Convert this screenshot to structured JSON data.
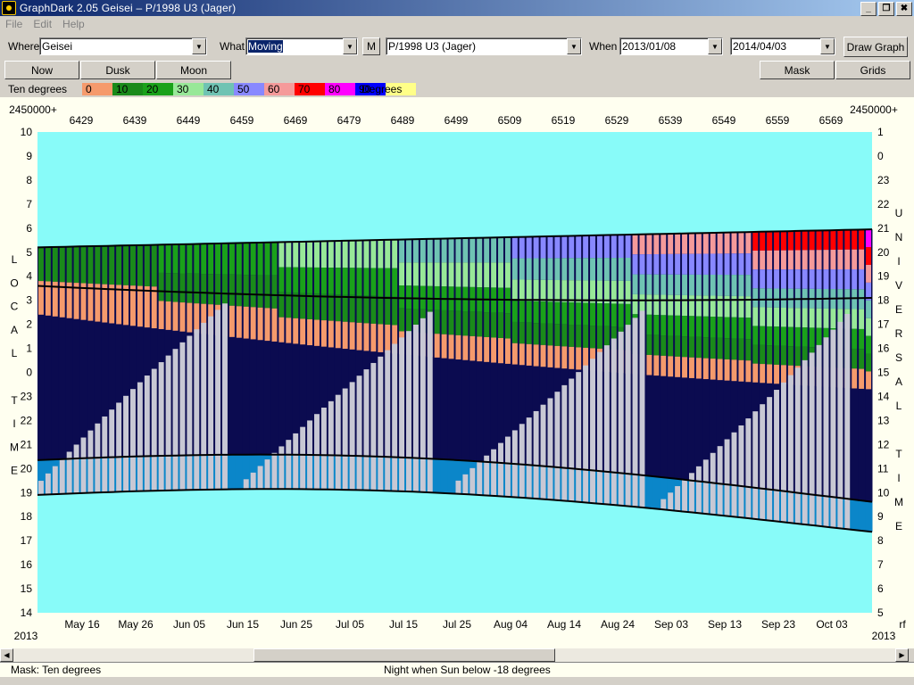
{
  "window": {
    "title": "GraphDark 2.05  Geisei  –  P/1998 U3 (Jager)",
    "buttons": [
      "_",
      "❐",
      "✖"
    ]
  },
  "menu": [
    "File",
    "Edit",
    "Help"
  ],
  "toolbar": {
    "where_label": "Where",
    "where_value": "Geisei",
    "what_label": "What",
    "what_value": "Moving",
    "m_button": "M",
    "object_value": "P/1998 U3 (Jager)",
    "when_label": "When",
    "start_date": "2013/01/08",
    "end_date": "2014/04/03",
    "draw_graph": "Draw Graph"
  },
  "buttons_row": {
    "now": "Now",
    "dusk": "Dusk",
    "moon": "Moon",
    "mask": "Mask",
    "grids": "Grids"
  },
  "legend": {
    "title": "Ten degrees",
    "unit": "Degrees",
    "items": [
      {
        "label": "0",
        "color": "#f59a6c"
      },
      {
        "label": "10",
        "color": "#1a8a1a"
      },
      {
        "label": "20",
        "color": "#1aa11a"
      },
      {
        "label": "30",
        "color": "#98e898"
      },
      {
        "label": "40",
        "color": "#6fc3b3"
      },
      {
        "label": "50",
        "color": "#8888ff"
      },
      {
        "label": "60",
        "color": "#f59a9a"
      },
      {
        "label": "70",
        "color": "#ff0000"
      },
      {
        "label": "80",
        "color": "#ff00ff"
      },
      {
        "label": "90",
        "color": "#0000ff"
      },
      {
        "label": "",
        "color": "#ffff88"
      }
    ]
  },
  "graph": {
    "colors": {
      "day": "#88fbf9",
      "night": "#0b0b50",
      "twilight": "#0b86c9",
      "moon_bar": "#c8c8d4"
    },
    "jd_prefix": "2450000+",
    "jd_ticks": [
      "6429",
      "6439",
      "6449",
      "6459",
      "6469",
      "6479",
      "6489",
      "6499",
      "6509",
      "6519",
      "6529",
      "6539",
      "6549",
      "6559",
      "6569"
    ],
    "date_ticks": [
      "May 16",
      "May 26",
      "Jun 05",
      "Jun 15",
      "Jun 25",
      "Jul 05",
      "Jul 15",
      "Jul 25",
      "Aug 04",
      "Aug 14",
      "Aug 24",
      "Sep 03",
      "Sep 13",
      "Sep 23",
      "Oct 03"
    ],
    "year_left": "2013",
    "year_right": "2013",
    "left_ticks": [
      "10",
      "9",
      "8",
      "7",
      "6",
      "5",
      "4",
      "3",
      "2",
      "1",
      "0",
      "23",
      "22",
      "21",
      "20",
      "19",
      "18",
      "17",
      "16",
      "15",
      "14"
    ],
    "right_ticks": [
      "1",
      "0",
      "23",
      "22",
      "21",
      "20",
      "19",
      "18",
      "17",
      "16",
      "15",
      "14",
      "13",
      "12",
      "11",
      "10",
      "9",
      "8",
      "7",
      "6",
      "5"
    ],
    "left_axis_letters": [
      "L",
      "O",
      "C",
      "A",
      "L",
      "",
      "T",
      "I",
      "M",
      "E"
    ],
    "right_axis_letters": [
      "U",
      "N",
      "I",
      "V",
      "E",
      "R",
      "S",
      "A",
      "L",
      "",
      "T",
      "I",
      "M",
      "E"
    ],
    "right_corner": "rf"
  },
  "status": {
    "left": "Mask:  Ten degrees",
    "center": "Night when Sun below -18 degrees"
  }
}
